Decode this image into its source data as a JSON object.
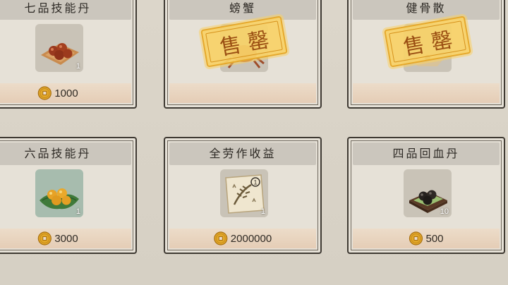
{
  "shop": {
    "cards": [
      {
        "title": "七品技能丹",
        "qty": "1",
        "price": "1000",
        "sold_out": false,
        "icon": "orange-pills-on-leaf-icon"
      },
      {
        "title": "螃蟹",
        "qty": "",
        "price": "",
        "sold_out": true,
        "stamp": "售罄",
        "icon": "crab-icon"
      },
      {
        "title": "健骨散",
        "qty": "",
        "price": "",
        "sold_out": true,
        "stamp": "售罄",
        "icon": "powder-packet-icon"
      },
      {
        "title": "六品技能丹",
        "qty": "1",
        "price": "3000",
        "sold_out": false,
        "icon": "yellow-pills-on-leaf-icon"
      },
      {
        "title": "全劳作收益",
        "qty": "1",
        "price": "2000000",
        "sold_out": false,
        "icon": "harvest-scroll-icon",
        "badge": "①"
      },
      {
        "title": "四品回血丹",
        "qty": "10",
        "price": "500",
        "sold_out": false,
        "icon": "black-pills-on-wood-icon"
      }
    ]
  },
  "colors": {
    "background": "#d8d2c6",
    "card": "#e6e1d7",
    "title_bar": "#cbc6bd",
    "price_bar": "#e5cdb6",
    "stamp": "#f7d268",
    "coin": "#e2a829"
  }
}
